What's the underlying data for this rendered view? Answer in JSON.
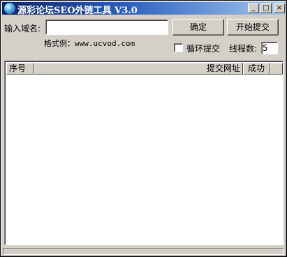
{
  "window": {
    "title": "源彩论坛SEO外链工具 V3.0",
    "controls": {
      "minimize": "_",
      "maximize": "□",
      "close": "×"
    }
  },
  "form": {
    "domain_label": "输入域名:",
    "domain_value": "",
    "format_example": "格式例：www.ucvod.com",
    "ok_button": "确定",
    "start_button": "开始提交",
    "loop_label": "循环提交",
    "loop_checked": false,
    "threads_label": "线程数:",
    "threads_value": "5"
  },
  "list": {
    "columns": [
      "序号",
      "提交网址",
      "成功"
    ],
    "rows": []
  }
}
